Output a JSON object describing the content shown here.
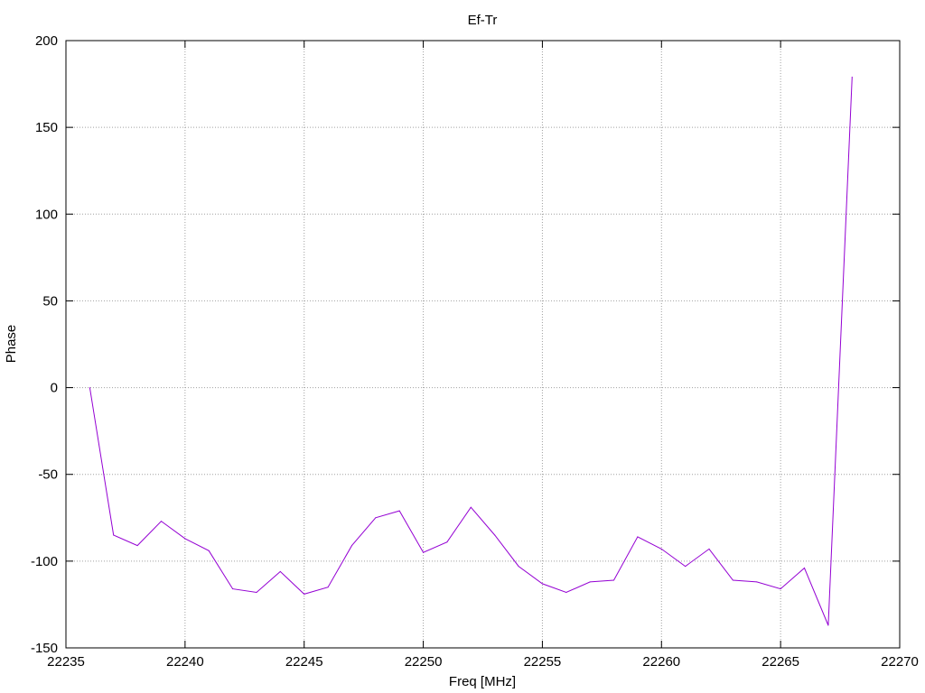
{
  "chart_data": {
    "type": "line",
    "title": "Ef-Tr",
    "xlabel": "Freq [MHz]",
    "ylabel": "Phase",
    "xlim": [
      22235,
      22270
    ],
    "ylim": [
      -150,
      200
    ],
    "xticks": [
      22235,
      22240,
      22245,
      22250,
      22255,
      22260,
      22265,
      22270
    ],
    "yticks": [
      -150,
      -100,
      -50,
      0,
      50,
      100,
      150,
      200
    ],
    "grid": true,
    "series": [
      {
        "color": "#9400d3",
        "x": [
          22236,
          22237,
          22238,
          22239,
          22240,
          22241,
          22242,
          22243,
          22244,
          22245,
          22246,
          22247,
          22248,
          22249,
          22250,
          22251,
          22252,
          22253,
          22254,
          22255,
          22256,
          22257,
          22258,
          22259,
          22260,
          22261,
          22262,
          22263,
          22264,
          22265,
          22266,
          22267,
          22268
        ],
        "y": [
          0,
          -85,
          -91,
          -77,
          -87,
          -94,
          -116,
          -118,
          -106,
          -119,
          -115,
          -91,
          -75,
          -71,
          -95,
          -89,
          -69,
          -85,
          -103,
          -113,
          -118,
          -112,
          -111,
          -86,
          -93,
          -103,
          -93,
          -111,
          -112,
          -116,
          -104,
          -137,
          179
        ]
      }
    ]
  }
}
